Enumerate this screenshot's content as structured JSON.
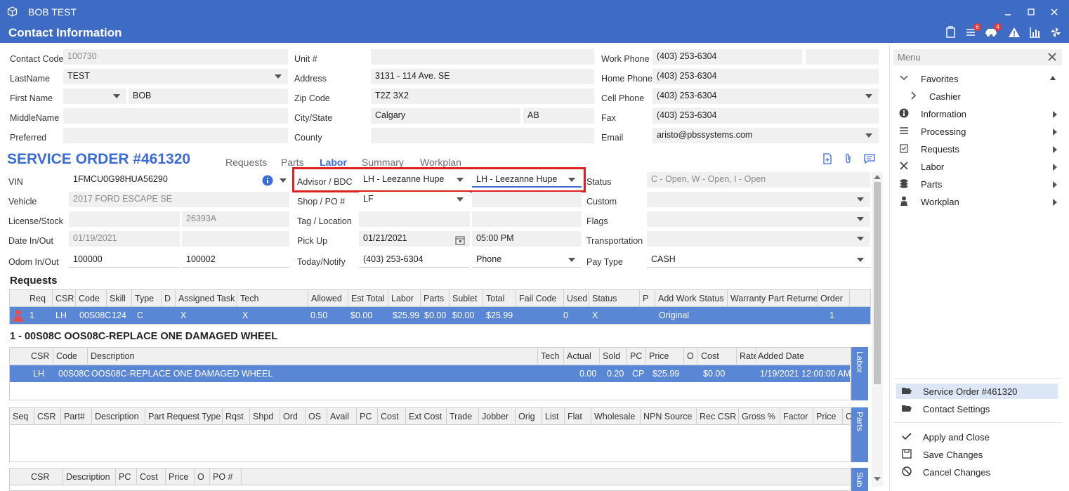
{
  "window": {
    "title": "BOB TEST",
    "header": "Contact Information",
    "badges": {
      "tasks": "6",
      "vehicles": "4"
    }
  },
  "contact": {
    "code_label": "Contact Code",
    "code": "100730",
    "lastname_label": "LastName",
    "lastname": "TEST",
    "firstname_label": "First Name",
    "firstname": "BOB",
    "middlename_label": "MiddleName",
    "middlename": "",
    "preferred_label": "Preferred",
    "preferred": "",
    "unit_label": "Unit #",
    "unit": "",
    "address_label": "Address",
    "address": "3131 - 114 Ave. SE",
    "zip_label": "Zip Code",
    "zip": "T2Z 3X2",
    "citystate_label": "City/State",
    "city": "Calgary",
    "state": "AB",
    "county_label": "County",
    "county": "",
    "workphone_label": "Work Phone",
    "workphone": "(403) 253-6304",
    "homephone_label": "Home Phone",
    "homephone": "(403) 253-6304",
    "cellphone_label": "Cell Phone",
    "cellphone": "(403) 253-6304",
    "fax_label": "Fax",
    "fax": "(403) 253-6304",
    "email_label": "Email",
    "email": "aristo@pbssystems.com"
  },
  "service_order": {
    "title": "SERVICE ORDER #461320",
    "tabs": [
      "Requests",
      "Parts",
      "Labor",
      "Summary",
      "Workplan"
    ],
    "vin_label": "VIN",
    "vin": "1FMCU0G98HUA56290",
    "vehicle_label": "Vehicle",
    "vehicle": "2017 FORD ESCAPE SE",
    "license_label": "License/Stock",
    "license": "",
    "stock": "26393A",
    "datein_label": "Date In/Out",
    "datein": "01/19/2021",
    "dateout": "",
    "odom_label": "Odom In/Out",
    "odom_in": "100000",
    "odom_out": "100002",
    "advisor_label": "Advisor / BDC",
    "advisor": "LH - Leezanne Hupe",
    "bdc": "LH - Leezanne Hupe",
    "shop_label": "Shop / PO #",
    "shop": "LF",
    "po": "",
    "tag_label": "Tag / Location",
    "tag": "",
    "location": "",
    "pickup_label": "Pick Up",
    "pickup_date": "01/21/2021",
    "pickup_time": "05:00 PM",
    "today_label": "Today/Notify",
    "today": "(403) 253-6304",
    "notify": "Phone",
    "status_label": "Status",
    "status": "C - Open, W - Open, I - Open",
    "custom_label": "Custom",
    "flags_label": "Flags",
    "transport_label": "Transportation",
    "paytype_label": "Pay Type",
    "paytype": "CASH"
  },
  "requests": {
    "title": "Requests",
    "headers": [
      "Req",
      "CSR",
      "Code",
      "Skill",
      "Type",
      "D",
      "Assigned Task",
      "Tech",
      "Allowed",
      "Est Total",
      "Labor",
      "Parts",
      "Sublet",
      "Total",
      "Fail Code",
      "Used",
      "Status",
      "P",
      "Add Work Status",
      "Warranty Part Returned",
      "Order"
    ],
    "row": [
      "1",
      "LH",
      "00S08C",
      "124",
      "C",
      "",
      "X",
      "X",
      "0.50",
      "$0.00",
      "$25.99",
      "$0.00",
      "$0.00",
      "$25.99",
      "",
      "0",
      "X",
      "",
      "Original",
      "",
      "1"
    ]
  },
  "labor": {
    "title": "1 - 00S08C OOS08C-REPLACE ONE DAMAGED WHEEL",
    "headers": [
      "CSR",
      "Code",
      "Description",
      "Tech",
      "Actual",
      "Sold",
      "PC",
      "Price",
      "O",
      "Cost",
      "Rate",
      "Added Date"
    ],
    "row": [
      "LH",
      "00S08C",
      "OOS08C-REPLACE ONE DAMAGED WHEEL",
      "",
      "0.00",
      "0.20",
      "CP",
      "$25.99",
      "",
      "$0.00",
      "",
      "1/19/2021 12:00:00 AM"
    ],
    "side_tab": "Labor"
  },
  "parts": {
    "headers": [
      "Seq",
      "CSR",
      "Part#",
      "Description",
      "Part Request Type",
      "Rqst",
      "Shpd",
      "Ord",
      "OS",
      "Avail",
      "PC",
      "Cost",
      "Ext Cost",
      "Trade",
      "Jobber",
      "Orig",
      "List",
      "Flat",
      "Wholesale",
      "NPN Source",
      "Rec CSR",
      "Gross %",
      "Factor",
      "Price",
      "C"
    ],
    "side_tab": "Parts"
  },
  "sublet": {
    "headers": [
      "CSR",
      "Description",
      "PC",
      "Cost",
      "Price",
      "O",
      "PO #"
    ],
    "side_tab": "Sub"
  },
  "menu": {
    "title": "Menu",
    "favorites": "Favorites",
    "cashier": "Cashier",
    "items": [
      "Information",
      "Processing",
      "Requests",
      "Labor",
      "Parts",
      "Workplan"
    ],
    "bottom": [
      "Service Order #461320",
      "Contact Settings"
    ],
    "actions": [
      "Apply and Close",
      "Save Changes",
      "Cancel Changes"
    ]
  },
  "colors": {
    "titlebar": "#3e6cc5",
    "accent": "#3a6bd6",
    "highlight": "#e02020",
    "row_selected": "#5a86d6"
  }
}
